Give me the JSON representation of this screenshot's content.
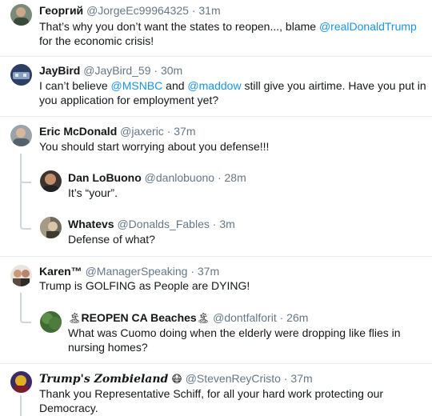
{
  "tweets": [
    {
      "name": "Георгий",
      "handle": "@JorgeEc99964325",
      "sep": "·",
      "time": "31m",
      "text_a": "That’s why you don’t want the states to reopen..., blame ",
      "mention_a": "@realDonaldTrump",
      "text_b": "for the economic crisis!"
    },
    {
      "name": "JayBird",
      "handle": "@JayBird_59",
      "sep": "·",
      "time": "30m",
      "text_a": "I can’t believe ",
      "mention_a": "@MSNBC",
      "text_b": " and ",
      "mention_b": "@maddow",
      "text_c": " still give you airtime. Have you put in",
      "text_d": "you application for employment yet?"
    },
    {
      "name": "Eric McDonald",
      "handle": "@jaxeric",
      "sep": "·",
      "time": "37m",
      "text_a": "You should start worrying about you defense!!!"
    },
    {
      "name": "Dan LoBuono",
      "handle": "@danlobuono",
      "sep": "·",
      "time": "28m",
      "text_a": "It’s “your”."
    },
    {
      "name": "Whatevs",
      "handle": "@Donalds_Fables",
      "sep": "·",
      "time": "3m",
      "text_a": "Defense of what?"
    },
    {
      "name": "Karen™",
      "handle": "@ManagerSpeaking",
      "sep": "·",
      "time": "37m",
      "text_a": "Trump is GOLFING as People are DYING!"
    },
    {
      "name_emoji_pre": "🏝",
      "name": "REOPEN CA Beaches",
      "name_emoji_post": "🏝",
      "handle": "@dontfalforit",
      "sep": "·",
      "time": "26m",
      "text_a": "What was Cuomo doing when the elderly were dropping like flies in",
      "text_b": "nursing homes?"
    },
    {
      "name": "Trump's Zombieland",
      "name_emoji_post": "😷",
      "handle": "@StevenReyCristo",
      "sep": "·",
      "time": "37m",
      "text_a": "Thank you Representative Schiff, for all your hard work protecting our",
      "text_b": "Democracy."
    }
  ],
  "colors": {
    "mention": "#1b95e0",
    "muted": "#657786",
    "thread_line": "#ccd6dd",
    "separator": "#e6ecf0"
  },
  "icons": [
    "avatar-photo",
    "island-emoji",
    "mask-emoji"
  ]
}
